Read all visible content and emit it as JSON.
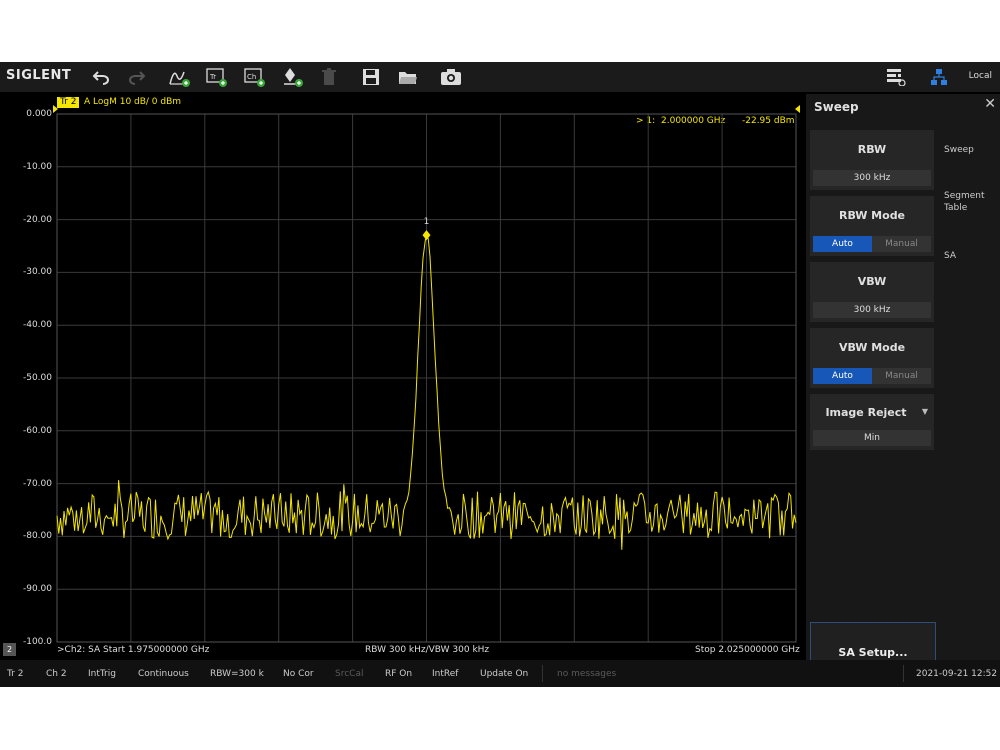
{
  "toolbar": {
    "logo": "SIGLENT",
    "icons": [
      "undo-icon",
      "redo-icon",
      "add-trace-icon",
      "add-trace-tr-icon",
      "add-channel-icon",
      "add-marker-icon",
      "delete-icon",
      "save-icon",
      "open-folder-icon",
      "camera-icon",
      "layout-icon",
      "network-icon"
    ],
    "local_label": "Local"
  },
  "trace": {
    "tag": "Tr 2",
    "info": "A  LogM  10 dB/  0 dBm"
  },
  "axis": {
    "y_labels": [
      "0.000",
      "-10.00",
      "-20.00",
      "-30.00",
      "-40.00",
      "-50.00",
      "-60.00",
      "-70.00",
      "-80.00",
      "-90.00",
      "-100.0"
    ]
  },
  "marker": {
    "readout_id": "> 1:",
    "readout_freq": "2.000000 GHz",
    "readout_level": "-22.95 dBm",
    "label": "1",
    "color": "#f3e600"
  },
  "plot_footer": {
    "channel_badge": "2",
    "start": ">Ch2: SA Start 1.975000000 GHz",
    "bw": "RBW 300 kHz/VBW 300 kHz",
    "stop": "Stop 2.025000000 GHz"
  },
  "panel": {
    "title": "Sweep",
    "rbw_label": "RBW",
    "rbw_value": "300 kHz",
    "rbw_mode_label": "RBW Mode",
    "rbw_mode_auto": "Auto",
    "rbw_mode_manual": "Manual",
    "vbw_label": "VBW",
    "vbw_value": "300 kHz",
    "vbw_mode_label": "VBW Mode",
    "vbw_mode_auto": "Auto",
    "vbw_mode_manual": "Manual",
    "image_reject_label": "Image Reject",
    "image_reject_value": "Min",
    "setup_button": "SA Setup...",
    "tabs": [
      "Sweep",
      "Segment Table",
      "SA"
    ]
  },
  "statusbar": {
    "items": [
      "Tr 2",
      "Ch 2",
      "IntTrig",
      "Continuous",
      "RBW=300 k",
      "No Cor",
      "SrcCal",
      "RF On",
      "IntRef",
      "Update On",
      "no messages"
    ],
    "datetime": "2021-09-21 12:52"
  },
  "chart_data": {
    "type": "line",
    "title": "",
    "xlabel": "",
    "ylabel": "",
    "xlim": [
      1.975,
      2.025
    ],
    "ylim": [
      -100,
      0
    ],
    "x_unit": "GHz",
    "y_unit": "dBm",
    "grid": true,
    "series": [
      {
        "color": "#f3e600",
        "noise_floor_db": -76,
        "peak": {
          "x": 2.0,
          "y": -22.95
        },
        "points": [
          [
            1.975,
            -77.5
          ],
          [
            1.976,
            -73.0
          ],
          [
            1.977,
            -78.5
          ],
          [
            1.978,
            -74.0
          ],
          [
            1.979,
            -76.5
          ],
          [
            1.98,
            -72.5
          ],
          [
            1.981,
            -79.0
          ],
          [
            1.982,
            -75.0
          ],
          [
            1.983,
            -77.0
          ],
          [
            1.984,
            -74.5
          ],
          [
            1.985,
            -78.0
          ],
          [
            1.986,
            -75.5
          ],
          [
            1.987,
            -80.5
          ],
          [
            1.988,
            -74.0
          ],
          [
            1.989,
            -76.0
          ],
          [
            1.99,
            -73.5
          ],
          [
            1.991,
            -77.5
          ],
          [
            1.992,
            -75.0
          ],
          [
            1.993,
            -78.5
          ],
          [
            1.994,
            -76.0
          ],
          [
            1.995,
            -74.5
          ],
          [
            1.996,
            -77.0
          ],
          [
            1.997,
            -75.5
          ],
          [
            1.998,
            -76.5
          ],
          [
            1.999,
            -74.0
          ],
          [
            2.0,
            -22.95
          ],
          [
            2.001,
            -74.5
          ],
          [
            2.002,
            -76.5
          ],
          [
            2.003,
            -73.5
          ],
          [
            2.004,
            -77.0
          ],
          [
            2.005,
            -75.0
          ],
          [
            2.006,
            -78.0
          ],
          [
            2.007,
            -74.5
          ],
          [
            2.008,
            -76.5
          ],
          [
            2.009,
            -73.0
          ],
          [
            2.01,
            -77.5
          ],
          [
            2.011,
            -75.5
          ],
          [
            2.012,
            -79.5
          ],
          [
            2.013,
            -74.0
          ],
          [
            2.014,
            -76.0
          ],
          [
            2.015,
            -73.5
          ],
          [
            2.016,
            -78.0
          ],
          [
            2.017,
            -75.0
          ],
          [
            2.018,
            -77.5
          ],
          [
            2.019,
            -74.5
          ],
          [
            2.02,
            -76.0
          ],
          [
            2.021,
            -78.5
          ],
          [
            2.022,
            -75.0
          ],
          [
            2.023,
            -77.0
          ],
          [
            2.024,
            -74.5
          ],
          [
            2.025,
            -76.5
          ]
        ]
      }
    ]
  }
}
